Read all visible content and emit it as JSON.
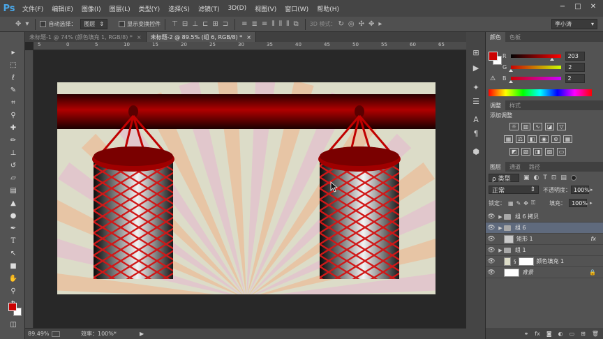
{
  "app": {
    "logo": "Ps"
  },
  "menu": [
    "文件(F)",
    "编辑(E)",
    "图像(I)",
    "图层(L)",
    "类型(Y)",
    "选择(S)",
    "滤镜(T)",
    "3D(D)",
    "视图(V)",
    "窗口(W)",
    "帮助(H)"
  ],
  "window_controls": {
    "minimize": "−",
    "maximize": "□",
    "close": "✕"
  },
  "options_bar": {
    "auto_select_label": "自动选择：",
    "auto_select_value": "图层",
    "transform_label": "显示变换控件",
    "mode_3d_label": "3D 模式：",
    "workspace": "李小涛"
  },
  "tabs": [
    {
      "label": "未标题-1 @ 74% (颜色填充 1, RGB/8) *",
      "close": "×"
    },
    {
      "label": "未标题-2 @ 89.5% (组 6, RGB/8) *",
      "close": "×"
    }
  ],
  "ruler": {
    "h_ticks": [
      "5",
      "0",
      "5",
      "10",
      "15",
      "20",
      "25",
      "30",
      "35",
      "40",
      "45",
      "50",
      "55",
      "60",
      "65"
    ]
  },
  "status": {
    "zoom": "89.49%",
    "efficiency": "效率：100%*",
    "arrow": "▶"
  },
  "color_panel": {
    "tabs": [
      "颜色",
      "色板"
    ],
    "r_label": "R",
    "g_label": "G",
    "b_label": "B",
    "r_value": "203",
    "g_value": "2",
    "b_value": "2",
    "r_level": 0.8,
    "g_level": 0.01,
    "b_level": 0.01,
    "foreground": "#cb0202",
    "background": "#ffffff"
  },
  "adjust_panel": {
    "tabs": [
      "调整",
      "样式"
    ],
    "title": "添加调整"
  },
  "layers_panel": {
    "tabs": [
      "图层",
      "通道",
      "路径"
    ],
    "filter_label": "ρ 类型",
    "blend_mode": "正常",
    "opacity_label": "不透明度：",
    "opacity_value": "100%",
    "lock_label": "锁定：",
    "fill_label": "填充：",
    "fill_value": "100%",
    "layers": [
      {
        "name": "组 6 拷贝",
        "type": "group",
        "selected": false
      },
      {
        "name": "组 6",
        "type": "group",
        "selected": true
      },
      {
        "name": "矩形 1",
        "type": "shape",
        "selected": false,
        "fx": "fx"
      },
      {
        "name": "组 1",
        "type": "group",
        "selected": false
      },
      {
        "name": "颜色填充 1",
        "type": "fill",
        "selected": false
      },
      {
        "name": "背景",
        "type": "background",
        "selected": false
      }
    ]
  },
  "colors": {
    "accent_red": "#cb0202",
    "canvas_bg": "#dcdcc8",
    "ui_dark": "#282828",
    "ui_panel": "#535353"
  }
}
